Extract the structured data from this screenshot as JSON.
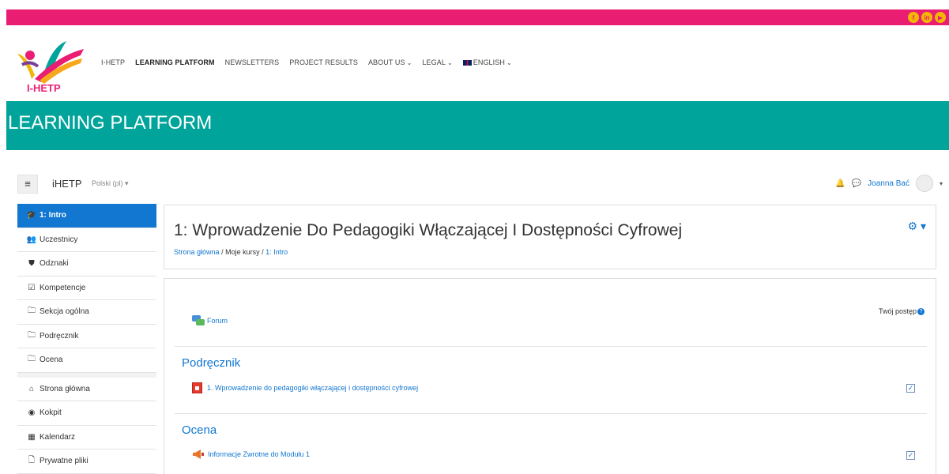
{
  "top_bar": {
    "social": [
      "f",
      "in",
      "yt"
    ]
  },
  "logo": {
    "text": "I-HETP"
  },
  "main_nav": {
    "items": [
      {
        "label": "I-HETP",
        "dropdown": false
      },
      {
        "label": "LEARNING PLATFORM",
        "dropdown": false,
        "active": true
      },
      {
        "label": "NEWSLETTERS",
        "dropdown": false
      },
      {
        "label": "PROJECT RESULTS",
        "dropdown": false
      },
      {
        "label": "ABOUT US",
        "dropdown": true
      },
      {
        "label": "LEGAL",
        "dropdown": true
      },
      {
        "label": "ENGLISH",
        "dropdown": true,
        "flag": "uk-flag-icon"
      }
    ]
  },
  "banner": {
    "title": "LEARNING PLATFORM"
  },
  "moodle_nav": {
    "brand": "iHETP",
    "language": "Polski (pl) ▾",
    "user_name": "Joanna Bać"
  },
  "drawer": {
    "course_items": [
      {
        "label": "1: Intro",
        "icon": "graduation-cap-icon",
        "glyph": "🎓",
        "active": true
      },
      {
        "label": "Uczestnicy",
        "icon": "users-icon",
        "glyph": "👥"
      },
      {
        "label": "Odznaki",
        "icon": "shield-icon",
        "glyph": "⛊"
      },
      {
        "label": "Kompetencje",
        "icon": "checkbox-icon",
        "glyph": "☑"
      },
      {
        "label": "Sekcja ogólna",
        "icon": "folder-icon",
        "glyph": "🗀"
      },
      {
        "label": "Podręcznik",
        "icon": "folder-icon",
        "glyph": "🗀"
      },
      {
        "label": "Ocena",
        "icon": "folder-icon",
        "glyph": "🗀"
      }
    ],
    "site_items": [
      {
        "label": "Strona główna",
        "icon": "home-icon",
        "glyph": "⌂"
      },
      {
        "label": "Kokpit",
        "icon": "dashboard-icon",
        "glyph": "◉"
      },
      {
        "label": "Kalendarz",
        "icon": "calendar-icon",
        "glyph": "▦"
      },
      {
        "label": "Prywatne pliki",
        "icon": "file-icon",
        "glyph": "🗋"
      }
    ]
  },
  "course_header": {
    "title": "1: Wprowadzenie Do Pedagogiki Włączającej I Dostępności Cyfrowej",
    "breadcrumb": [
      "Strona główna",
      "Moje kursy",
      "1: Intro"
    ]
  },
  "content": {
    "progress_label": "Twój postęp",
    "general_activity": "Forum",
    "sections": [
      {
        "title": "Podręcznik",
        "activity": "1. Wprowadzenie do pedagogiki włączającej i dostępności cyfrowej",
        "activity_icon": "pdf-icon",
        "completed": true
      },
      {
        "title": "Ocena",
        "activity": "Informacje Zwrotne do Modułu 1",
        "activity_icon": "feedback-megaphone-icon",
        "completed": true
      }
    ]
  },
  "colors": {
    "top_bar": "#e91e73",
    "banner": "#00a49a",
    "link": "#1177d1",
    "drawer_active": "#1177d1"
  }
}
